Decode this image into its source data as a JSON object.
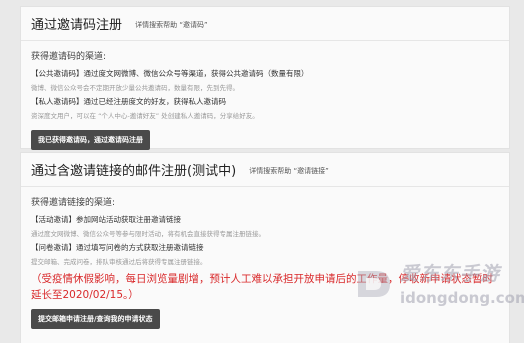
{
  "panel1": {
    "title": "通过邀请码注册",
    "help": "详情搜索帮助 “邀请码”",
    "subtitle": "获得邀请码的渠道:",
    "items": [
      {
        "title": "【公共邀请码】通过度文网微博、微信公众号等渠道，获得公共邀请码（数量有限）",
        "desc": "微博、微信公众号会不定期开放少量公共邀请码，数量有限，先到先得。"
      },
      {
        "title": "【私人邀请码】通过已经注册度文的好友，获得私人邀请码",
        "desc": "资深度文用户，可以在 “个人中心-邀请好友” 处创建私人邀请码，分享给好友。"
      }
    ],
    "button": "我已获得邀请码，通过邀请码注册"
  },
  "panel2": {
    "title": "通过含邀请链接的邮件注册(测试中)",
    "help": "详情搜索帮助 “邀请链接”",
    "subtitle": "获得邀请链接的渠道:",
    "items": [
      {
        "title": "【活动邀请】参加网站活动获取注册邀请链接",
        "desc": "通过度文网微博、微信公众号等参与限时活动，将有机会直接获得专属注册链接。"
      },
      {
        "title": "【问卷邀请】通过填写问卷的方式获取注册邀请链接",
        "desc": "提交邮箱、完成问卷，排队审核通过后将获得专属注册链接。"
      }
    ],
    "notice": "（受疫情休假影响，每日浏览量剧增，预计人工难以承担开放申请后的工作量，停收新申请状态暂时延长至2020/02/15。）",
    "button": "提交邮箱申请注册/查询我的申请状态"
  },
  "watermark": {
    "text": "爱东东手游",
    "url": "idongdong.com"
  },
  "colors": {
    "notice": "#d9292b",
    "button_bg": "#4a4a4a",
    "panel_bg": "#fafafa",
    "page_bg": "#e9e9e9"
  }
}
